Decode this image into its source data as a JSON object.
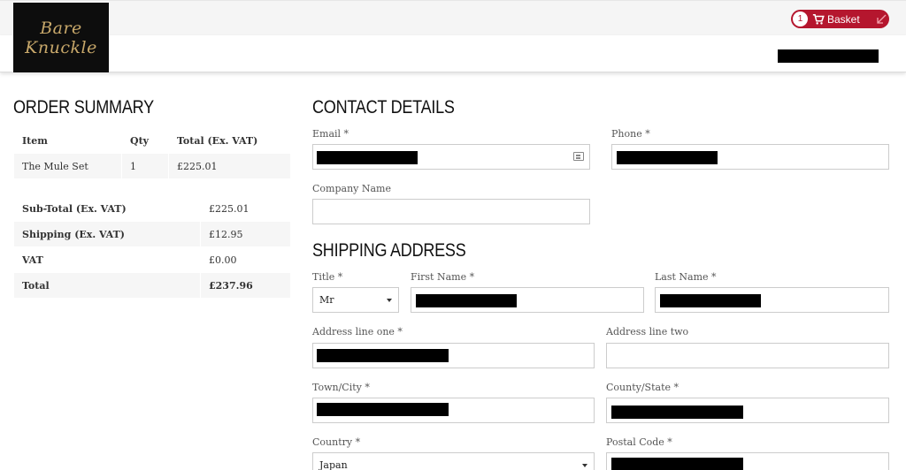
{
  "brand": {
    "line1": "Bare",
    "line2": "Knuckle"
  },
  "basket": {
    "count": "1",
    "label": "Basket",
    "accent": "#b5162e"
  },
  "order_summary": {
    "title": "ORDER SUMMARY",
    "columns": [
      "Item",
      "Qty",
      "Total (Ex. VAT)"
    ],
    "items": [
      {
        "name": "The Mule Set",
        "qty": "1",
        "total": "£225.01"
      }
    ],
    "totals": [
      {
        "label": "Sub-Total (Ex. VAT)",
        "value": "£225.01"
      },
      {
        "label": "Shipping (Ex. VAT)",
        "value": "£12.95"
      },
      {
        "label": "VAT",
        "value": "£0.00"
      },
      {
        "label": "Total",
        "value": "£237.96"
      }
    ]
  },
  "contact": {
    "title": "CONTACT DETAILS",
    "email_label": "Email *",
    "phone_label": "Phone *",
    "company_label": "Company Name",
    "company_value": ""
  },
  "shipping": {
    "title": "SHIPPING ADDRESS",
    "title_label": "Title *",
    "title_value": "Mr",
    "first_name_label": "First Name *",
    "last_name_label": "Last Name *",
    "address1_label": "Address line one *",
    "address2_label": "Address line two",
    "address2_value": "",
    "town_label": "Town/City *",
    "county_label": "County/State *",
    "country_label": "Country *",
    "country_value": "Japan",
    "postal_label": "Postal Code *"
  }
}
